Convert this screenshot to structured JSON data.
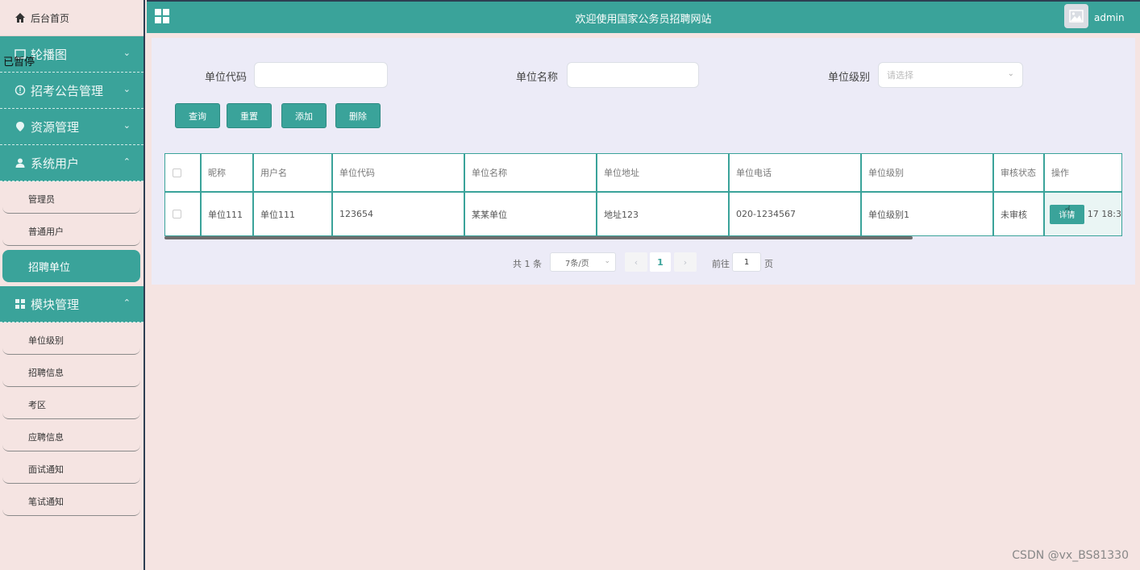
{
  "sidebar": {
    "home_label": "后台首页",
    "menus": [
      {
        "label": "轮播图",
        "chevron": "⌄"
      },
      {
        "label": "招考公告管理",
        "chevron": "⌄"
      },
      {
        "label": "资源管理",
        "chevron": "⌄"
      },
      {
        "label": "系统用户",
        "chevron": "⌃"
      },
      {
        "label": "模块管理",
        "chevron": "⌃"
      }
    ],
    "system_users_items": [
      "管理员",
      "普通用户",
      "招聘单位"
    ],
    "module_items": [
      "单位级别",
      "招聘信息",
      "考区",
      "应聘信息",
      "面试通知",
      "笔试通知"
    ]
  },
  "overlay_text": "已暂停",
  "header": {
    "title": "欢迎使用国家公务员招聘网站",
    "username": "admin"
  },
  "filters": {
    "code_label": "单位代码",
    "code_value": "",
    "name_label": "单位名称",
    "name_value": "",
    "level_label": "单位级别",
    "level_placeholder": "请选择"
  },
  "buttons": {
    "query": "查询",
    "reset": "重置",
    "add": "添加",
    "delete": "删除"
  },
  "table": {
    "columns": [
      "昵称",
      "用户名",
      "单位代码",
      "单位名称",
      "单位地址",
      "单位电话",
      "单位级别",
      "审核状态",
      "操作"
    ],
    "rows": [
      {
        "nickname": "单位111",
        "username": "单位111",
        "code": "123654",
        "name": "某某单位",
        "address": "地址123",
        "phone": "020-1234567",
        "level": "单位级别1",
        "status": "未审核",
        "op_button": "详情",
        "op_extra": "17 18:3"
      }
    ]
  },
  "pagination": {
    "total": "共 1 条",
    "page_size": "7条/页",
    "current_page": "1",
    "goto_label": "前往",
    "goto_value": "1",
    "page_suffix": "页"
  },
  "watermark": "CSDN @vx_BS81330",
  "colors": {
    "primary": "#3aa39a",
    "background": "#f5e4e2",
    "panel": "#ecebf7"
  }
}
